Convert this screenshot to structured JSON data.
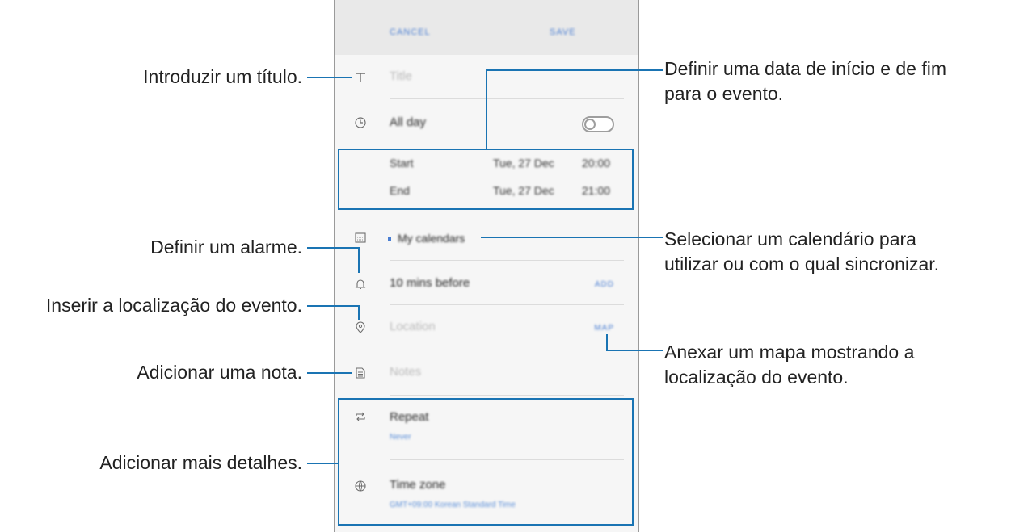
{
  "app": {
    "cancel_label": "CANCEL",
    "save_label": "SAVE",
    "title_placeholder": "Title",
    "all_day_label": "All day",
    "start_label": "Start",
    "start_date": "Tue, 27 Dec",
    "start_time": "20:00",
    "end_label": "End",
    "end_date": "Tue, 27 Dec",
    "end_time": "21:00",
    "calendar_label": "My calendars",
    "reminder_label": "10 mins before",
    "reminder_action": "ADD",
    "location_placeholder": "Location",
    "map_label": "MAP",
    "notes_placeholder": "Notes",
    "repeat_label": "Repeat",
    "repeat_value": "Never",
    "timezone_label": "Time zone",
    "timezone_value": "GMT+09:00 Korean Standard Time"
  },
  "annotations": {
    "title": "Introduzir um título.",
    "dates_line1": "Definir uma data de início e de fim",
    "dates_line2": "para o evento.",
    "alarm": "Definir um alarme.",
    "calendar_line1": "Selecionar um calendário para",
    "calendar_line2": "utilizar ou com o qual sincronizar.",
    "location": "Inserir a localização do evento.",
    "map_line1": "Anexar um mapa mostrando a",
    "map_line2": "localização do evento.",
    "note": "Adicionar uma nota.",
    "details": "Adicionar mais detalhes."
  },
  "icons": {
    "title": "text-icon",
    "all_day": "clock-icon",
    "calendar": "calendar-icon",
    "reminder": "bell-icon",
    "location": "location-pin-icon",
    "notes": "notes-icon",
    "repeat": "repeat-icon",
    "timezone": "globe-icon"
  },
  "colors": {
    "accent": "#1a74b3",
    "link": "#4a7ed2"
  }
}
